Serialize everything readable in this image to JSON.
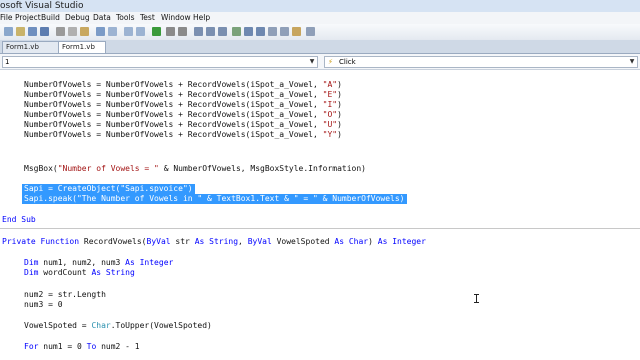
{
  "window": {
    "title": "osoft Visual Studio"
  },
  "menu": [
    "File",
    "Project",
    "Build",
    "Debug",
    "Data",
    "Tools",
    "Test",
    "Window",
    "Help"
  ],
  "tabs": [
    {
      "label": "Form1.vb [Design]"
    },
    {
      "label": "Form1.vb"
    }
  ],
  "nav": {
    "object_value": "1",
    "event_value": "Click",
    "event_icon": "lightning-icon"
  },
  "colors": {
    "keyword": "#0000ff",
    "string": "#a31515",
    "type": "#2b91af",
    "selection": "#3399ff"
  },
  "code": {
    "l1": {
      "a": "NumberOfVowels = NumberOfVowels + RecordVowels(iSpot_a_Vowel, ",
      "b": "\"A\"",
      "c": ")"
    },
    "l2": {
      "a": "NumberOfVowels = NumberOfVowels + RecordVowels(iSpot_a_Vowel, ",
      "b": "\"E\"",
      "c": ")"
    },
    "l3": {
      "a": "NumberOfVowels = NumberOfVowels + RecordVowels(iSpot_a_Vowel, ",
      "b": "\"I\"",
      "c": ")"
    },
    "l4": {
      "a": "NumberOfVowels = NumberOfVowels + RecordVowels(iSpot_a_Vowel, ",
      "b": "\"O\"",
      "c": ")"
    },
    "l5": {
      "a": "NumberOfVowels = NumberOfVowels + RecordVowels(iSpot_a_Vowel, ",
      "b": "\"U\"",
      "c": ")"
    },
    "l6": {
      "a": "NumberOfVowels = NumberOfVowels + RecordVowels(iSpot_a_Vowel, ",
      "b": "\"Y\"",
      "c": ")"
    },
    "msgbox": {
      "a": "MsgBox(",
      "b": "\"Number of Vowels = \"",
      "c": " & NumberOfVowels, MsgBoxStyle.Information)"
    },
    "sapi1": "Sapi = CreateObject(\"Sapi.spvoice\")",
    "sapi2": "Sapi.speak(\"The Number of Vowels in \" & TextBox1.Text & \" = \" & NumberOfVowels)",
    "endsub": "End Sub",
    "func": {
      "k1": "Private Function",
      "a": " RecordVowels(",
      "k2": "ByVal",
      "b": " str ",
      "k3": "As String",
      "c": ", ",
      "k4": "ByVal",
      "d": " VowelSpoted ",
      "k5": "As Char",
      "e": ") ",
      "k6": "As Integer"
    },
    "dim1": {
      "k1": "Dim",
      "a": " num1, num2, num3 ",
      "k2": "As Integer"
    },
    "dim2": {
      "k1": "Dim",
      "a": " wordCount ",
      "k2": "As String"
    },
    "num2": "num2 = str.Length",
    "num3": "num3 = 0",
    "vowel": {
      "a": "VowelSpoted = ",
      "t": "Char",
      "b": ".ToUpper(VowelSpoted)"
    },
    "for": {
      "k1": "For",
      "a": " num1 = 0 ",
      "k2": "To",
      "b": " num2 - 1"
    }
  }
}
